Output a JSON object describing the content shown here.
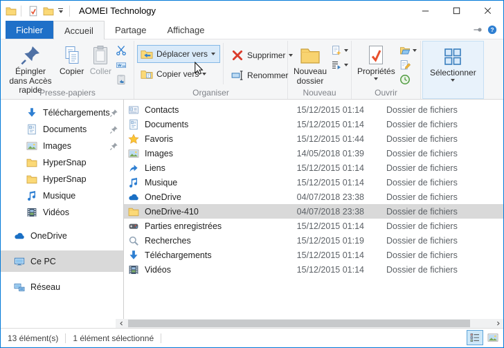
{
  "colors": {
    "accent_blue": "#1f70c8",
    "window_border": "#0078d7",
    "selection_gray": "#d9d9d9",
    "delete_red": "#da3b2b"
  },
  "titlebar": {
    "title": "AOMEI Technology"
  },
  "tabs": {
    "file": "Fichier",
    "home": "Accueil",
    "share": "Partage",
    "view": "Affichage"
  },
  "ribbon": {
    "pin_quick_access": "Épingler dans Accès rapide",
    "copy": "Copier",
    "paste": "Coller",
    "move_to": "Déplacer vers",
    "copy_to": "Copier vers",
    "delete": "Supprimer",
    "rename": "Renommer",
    "new_folder": "Nouveau dossier",
    "properties": "Propriétés",
    "select": "Sélectionner",
    "groups": {
      "clipboard": "Presse-papiers",
      "organize": "Organiser",
      "new": "Nouveau",
      "open": "Ouvrir"
    }
  },
  "sidebar": {
    "items": [
      {
        "label": "Téléchargements",
        "icon": "download-icon",
        "pinned": true
      },
      {
        "label": "Documents",
        "icon": "document-icon",
        "pinned": true
      },
      {
        "label": "Images",
        "icon": "image-icon",
        "pinned": true
      },
      {
        "label": "HyperSnap",
        "icon": "folder-icon",
        "pinned": false
      },
      {
        "label": "HyperSnap",
        "icon": "folder-icon",
        "pinned": false
      },
      {
        "label": "Musique",
        "icon": "music-icon",
        "pinned": false
      },
      {
        "label": "Vidéos",
        "icon": "video-icon",
        "pinned": false
      },
      {
        "label": "OneDrive",
        "icon": "onedrive-icon",
        "root": true
      },
      {
        "label": "Ce PC",
        "icon": "computer-icon",
        "root": true,
        "selected": true
      },
      {
        "label": "Réseau",
        "icon": "network-icon",
        "root": true
      }
    ]
  },
  "files": {
    "rows": [
      {
        "name": "Contacts",
        "date": "15/12/2015 01:14",
        "type": "Dossier de fichiers",
        "icon": "contacts-icon"
      },
      {
        "name": "Documents",
        "date": "15/12/2015 01:14",
        "type": "Dossier de fichiers",
        "icon": "document-icon"
      },
      {
        "name": "Favoris",
        "date": "15/12/2015 01:44",
        "type": "Dossier de fichiers",
        "icon": "star-icon"
      },
      {
        "name": "Images",
        "date": "14/05/2018 01:39",
        "type": "Dossier de fichiers",
        "icon": "image-icon"
      },
      {
        "name": "Liens",
        "date": "15/12/2015 01:14",
        "type": "Dossier de fichiers",
        "icon": "link-icon"
      },
      {
        "name": "Musique",
        "date": "15/12/2015 01:14",
        "type": "Dossier de fichiers",
        "icon": "music-icon"
      },
      {
        "name": "OneDrive",
        "date": "04/07/2018 23:38",
        "type": "Dossier de fichiers",
        "icon": "onedrive-icon"
      },
      {
        "name": "OneDrive-410",
        "date": "04/07/2018 23:38",
        "type": "Dossier de fichiers",
        "icon": "folder-icon",
        "selected": true
      },
      {
        "name": "Parties enregistrées",
        "date": "15/12/2015 01:14",
        "type": "Dossier de fichiers",
        "icon": "game-icon"
      },
      {
        "name": "Recherches",
        "date": "15/12/2015 01:19",
        "type": "Dossier de fichiers",
        "icon": "search-icon"
      },
      {
        "name": "Téléchargements",
        "date": "15/12/2015 01:14",
        "type": "Dossier de fichiers",
        "icon": "download-icon"
      },
      {
        "name": "Vidéos",
        "date": "15/12/2015 01:14",
        "type": "Dossier de fichiers",
        "icon": "video-icon"
      }
    ]
  },
  "statusbar": {
    "items_count": "13 élément(s)",
    "selection_count": "1 élément sélectionné"
  }
}
